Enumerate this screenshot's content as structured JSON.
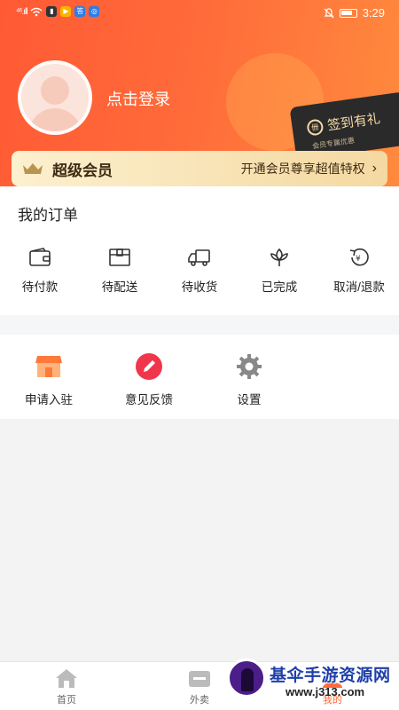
{
  "status_bar": {
    "signal_text": "⁴⁶.ıll",
    "time": "3:29",
    "icons": [
      "signal-icon",
      "wifi-icon",
      "notification-app-icons",
      "mute-icon",
      "battery-icon"
    ]
  },
  "profile": {
    "login_text": "点击登录"
  },
  "signin_card": {
    "title": "签到有礼",
    "subtitle": "会员专属优惠"
  },
  "vip_banner": {
    "title": "超级会员",
    "desc": "开通会员尊享超值特权",
    "chevron": "›"
  },
  "orders": {
    "title": "我的订单",
    "items": [
      {
        "label": "待付款",
        "icon": "wallet-icon"
      },
      {
        "label": "待配送",
        "icon": "package-icon"
      },
      {
        "label": "待收货",
        "icon": "truck-icon"
      },
      {
        "label": "已完成",
        "icon": "flower-icon"
      },
      {
        "label": "取消/退款",
        "icon": "refund-icon"
      }
    ]
  },
  "services": [
    {
      "label": "申请入驻",
      "icon": "store-icon"
    },
    {
      "label": "意见反馈",
      "icon": "pencil-icon"
    },
    {
      "label": "设置",
      "icon": "gear-icon"
    }
  ],
  "tabbar": [
    {
      "label": "首页",
      "icon": "home-icon"
    },
    {
      "label": "外卖",
      "icon": "takeout-icon"
    },
    {
      "label": "我的",
      "icon": "profile-icon"
    }
  ],
  "watermark": {
    "title": "基伞手游资源网",
    "url": "www.j313.com"
  },
  "colors": {
    "header_start": "#ff5a34",
    "header_end": "#ff8a3d",
    "accent": "#ff6a3a",
    "vip_gold": "#f4d9a1"
  }
}
